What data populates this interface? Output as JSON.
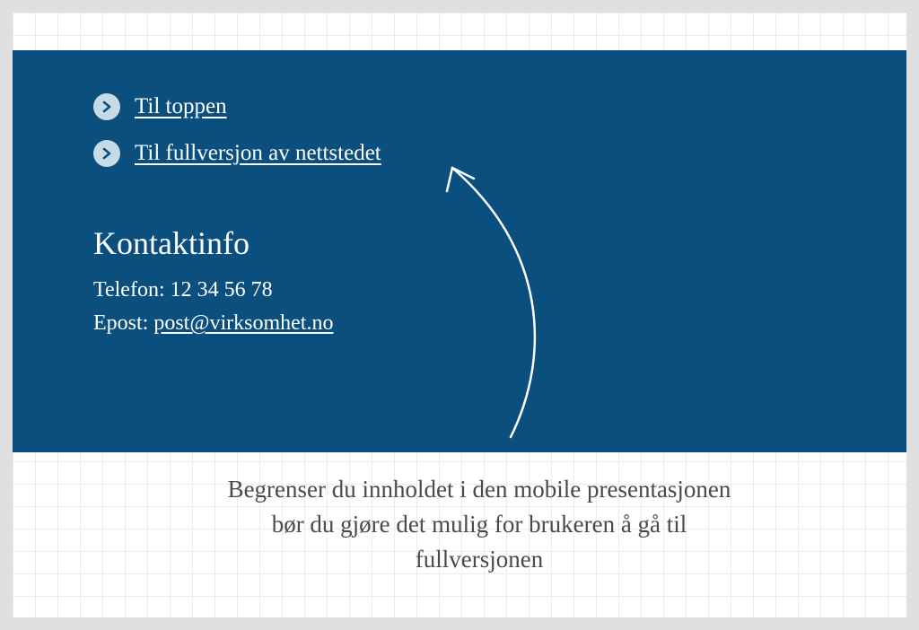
{
  "footer": {
    "links": [
      {
        "label": "Til toppen"
      },
      {
        "label": "Til fullversjon av nettstedet"
      }
    ],
    "contact": {
      "heading": "Kontaktinfo",
      "phone_label": "Telefon:",
      "phone_value": "12 34 56 78",
      "email_label": "Epost:",
      "email_value": "post@virksomhet.no"
    }
  },
  "annotation": "Begrenser du innholdet i den mobile presentasjonen bør du gjøre det mulig for brukeren å gå til fullversjonen"
}
